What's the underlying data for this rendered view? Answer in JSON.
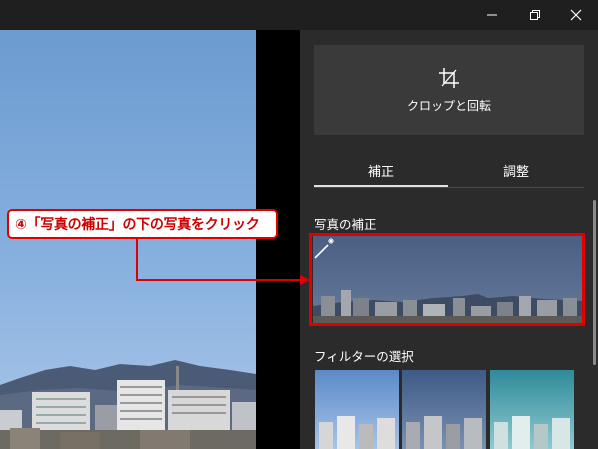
{
  "window_controls": {
    "minimize_icon": "minimize-icon",
    "restore_icon": "restore-icon",
    "close_icon": "close-icon"
  },
  "panel": {
    "crop_button": {
      "icon": "crop-icon",
      "label": "クロップと回転"
    },
    "tabs": [
      {
        "label": "補正",
        "selected": true
      },
      {
        "label": "調整",
        "selected": false
      }
    ],
    "enhance_section": {
      "title": "写真の補正",
      "wand_icon": "magic-wand-icon"
    },
    "filter_section": {
      "title": "フィルターの選択"
    }
  },
  "annotation": {
    "text": "④「写真の補正」の下の写真をクリック",
    "color": "#e00000"
  }
}
